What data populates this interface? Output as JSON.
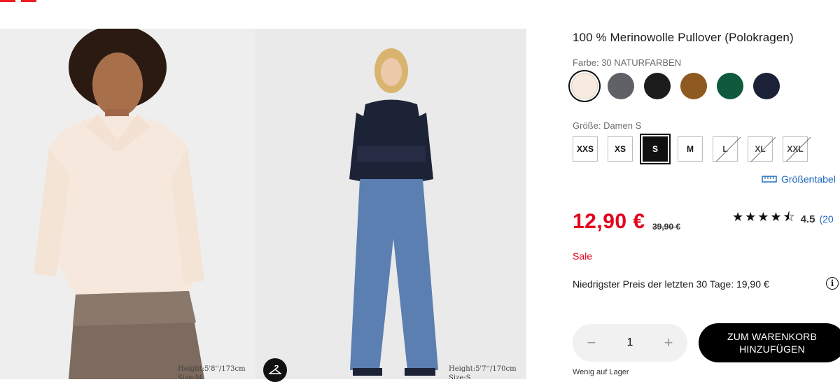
{
  "colors": {
    "brand_red": "#ed1d24",
    "price_red": "#e3001b",
    "link_blue": "#1a66b9"
  },
  "gallery": {
    "left_caption": {
      "height": "Height:5'8''/173cm",
      "size": "Size:M"
    },
    "right_caption": {
      "height": "Height:5'7''/170cm",
      "size": "Size:S"
    },
    "hanger_icon": "hanger-icon"
  },
  "product": {
    "title": "100 % Merinowolle Pullover (Polokragen)",
    "color_label": "Farbe: 30 NATURFARBEN",
    "swatches": [
      {
        "name": "natural",
        "hex": "#f7ebe0",
        "selected": true
      },
      {
        "name": "gray",
        "hex": "#5f6166",
        "selected": false
      },
      {
        "name": "black",
        "hex": "#1c1c1c",
        "selected": false
      },
      {
        "name": "brown",
        "hex": "#8e5a1f",
        "selected": false
      },
      {
        "name": "green",
        "hex": "#0f5a3d",
        "selected": false
      },
      {
        "name": "navy",
        "hex": "#1b2238",
        "selected": false
      }
    ],
    "size_label": "Größe: Damen S",
    "sizes": [
      {
        "label": "XXS",
        "state": "available"
      },
      {
        "label": "XS",
        "state": "available"
      },
      {
        "label": "S",
        "state": "selected"
      },
      {
        "label": "M",
        "state": "available"
      },
      {
        "label": "L",
        "state": "unavailable"
      },
      {
        "label": "XL",
        "state": "unavailable"
      },
      {
        "label": "XXL",
        "state": "unavailable"
      }
    ],
    "size_table_link": "Größentabel",
    "price": "12,90 €",
    "old_price": "39,90 €",
    "rating": {
      "stars": "★★★★⯪",
      "value": "4.5",
      "count": "(20"
    },
    "sale_label": "Sale",
    "lowest_price": "Niedrigster Preis der letzten 30 Tage: 19,90 €",
    "info_icon": "i",
    "quantity": {
      "minus": "−",
      "value": "1",
      "plus": "+"
    },
    "add_to_cart": [
      "ZUM WARENKORB",
      "HINZUFÜGEN"
    ],
    "stock": "Wenig auf Lager"
  }
}
